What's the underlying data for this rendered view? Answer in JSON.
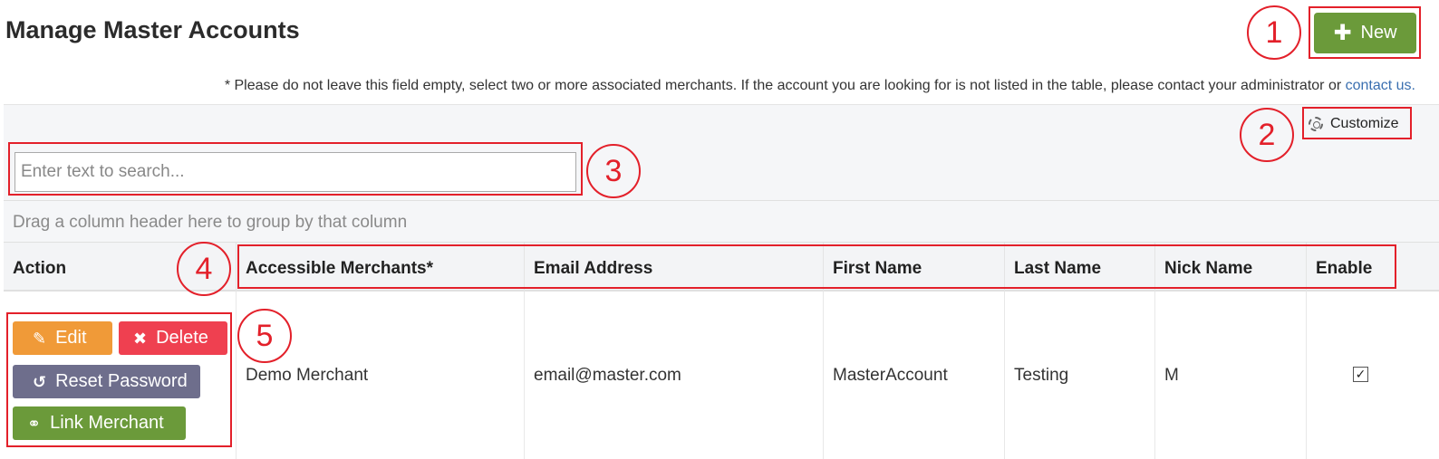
{
  "header": {
    "title": "Manage Master Accounts",
    "new_button": "New"
  },
  "note": {
    "text": "* Please do not leave this field empty, select two or more associated merchants. If the account you are looking for is not listed in the table, please contact your administrator or ",
    "link": "contact us."
  },
  "toolbar": {
    "customize_label": "Customize",
    "search_placeholder": "Enter text to search..."
  },
  "grid": {
    "group_panel_text": "Drag a column header here to group by that column",
    "columns": [
      "Action",
      "Accessible Merchants*",
      "Email Address",
      "First Name",
      "Last Name",
      "Nick Name",
      "Enable"
    ],
    "rows": [
      {
        "merchants": "Demo Merchant",
        "email": "email@master.com",
        "first_name": "MasterAccount",
        "last_name": "Testing",
        "nick_name": "M",
        "enabled": true,
        "check_mark": "✓"
      }
    ],
    "actions": {
      "edit": "Edit",
      "delete": "Delete",
      "reset_password": "Reset Password",
      "link_merchant": "Link Merchant"
    }
  },
  "annotations": [
    "1",
    "2",
    "3",
    "4",
    "5"
  ],
  "colors": {
    "new_green": "#6b9a3a",
    "edit_orange": "#f09a38",
    "delete_red": "#ef4050",
    "reset_purple": "#6e6e8c",
    "annotation_red": "#e3202a"
  }
}
